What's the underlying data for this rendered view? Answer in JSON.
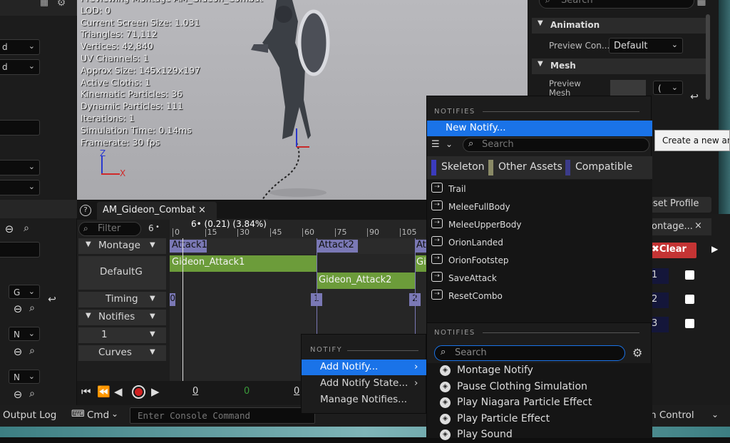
{
  "viewport": {
    "stats": [
      "Previewing Montage AM_Gideon_Combat",
      "LOD: 0",
      "Current Screen Size: 1.031",
      "Triangles: 71,112",
      "Vertices: 42,840",
      "UV Channels: 1",
      "Approx Size: 145x129x197",
      "Active Cloths: 1",
      "Kinematic Particles: 36",
      "Dynamic Particles: 111",
      "Iterations: 1",
      "Simulation Time: 0.14ms",
      "Framerate: 30 fps"
    ],
    "axis": {
      "z": "Z",
      "x": "X"
    }
  },
  "left_panel": {
    "dd1": "d",
    "dd2": "d",
    "g_dd": "G",
    "n_dd1": "N",
    "n_dd2": "N"
  },
  "details": {
    "search_placeholder": "Search",
    "animation_header": "Animation",
    "preview_controller_label": "Preview Con...",
    "preview_controller_value": "Default",
    "mesh_header": "Mesh",
    "preview_mesh_label": "Preview Mesh (Animation)",
    "preview_mesh_dd": "("
  },
  "tooltip": "Create a new anim",
  "reset_profile": "eset Profile",
  "montage_tab": {
    "label": "ontage...",
    "close": "×",
    "clear": "Clear",
    "rows": [
      "1",
      "2",
      "3"
    ]
  },
  "anim_tab": {
    "label": "AM_Gideon_Combat",
    "close": "×"
  },
  "timeline": {
    "filter_placeholder": "Filter",
    "count": "6",
    "frame_readout": "6• (0.21) (3.84%)",
    "ticks": [
      "0",
      "15",
      "30",
      "45",
      "60",
      "75",
      "90",
      "105"
    ],
    "tracks": [
      {
        "label": "Montage",
        "type": "section"
      },
      {
        "label": "DefaultG",
        "type": "slot"
      },
      {
        "label": "Timing",
        "type": "section"
      },
      {
        "label": "Notifies",
        "type": "section"
      },
      {
        "label": "1",
        "type": "sub"
      },
      {
        "label": "Curves",
        "type": "section"
      }
    ],
    "sections": [
      "Attack1",
      "Attack2",
      "At"
    ],
    "segments": [
      "Gideon_Attack1",
      "Gideon_Attack2",
      "Gi"
    ],
    "timing_markers": [
      "0",
      "1",
      "2"
    ],
    "transport_counters": [
      "0",
      "0",
      "0"
    ]
  },
  "notify_context_menu": {
    "header": "NOTIFY",
    "items": [
      {
        "label": "Add Notify...",
        "submenu": true
      },
      {
        "label": "Add Notify State...",
        "submenu": true
      },
      {
        "label": "Manage Notifies...",
        "submenu": false
      }
    ]
  },
  "notifies_submenu": {
    "header": "NOTIFIES",
    "new_notify": "New Notify...",
    "search_placeholder": "Search",
    "filters": [
      {
        "label": "Skeleton",
        "color": "#3b3bbd"
      },
      {
        "label": "Other Assets",
        "color": "#8a8a66"
      },
      {
        "label": "Compatible",
        "color": "#3b3b8a"
      }
    ],
    "items": [
      "Trail",
      "MeleeFullBody",
      "MeleeUpperBody",
      "OrionLanded",
      "OrionFootstep",
      "SaveAttack",
      "ResetCombo"
    ]
  },
  "class_submenu": {
    "header": "NOTIFIES",
    "search_placeholder": "Search",
    "items": [
      "Montage Notify",
      "Pause Clothing Simulation",
      "Play Niagara Particle Effect",
      "Play Particle Effect",
      "Play Sound"
    ]
  },
  "bottom_bar": {
    "output_log": "Output Log",
    "cmd": "Cmd",
    "console_placeholder": "Enter Console Command",
    "revision_control": "n Control"
  },
  "colors": {
    "accent_blue": "#1a73e8",
    "section_purple": "#7a78b5",
    "segment_green": "#6c9c3a",
    "clear_red": "#c43434"
  }
}
